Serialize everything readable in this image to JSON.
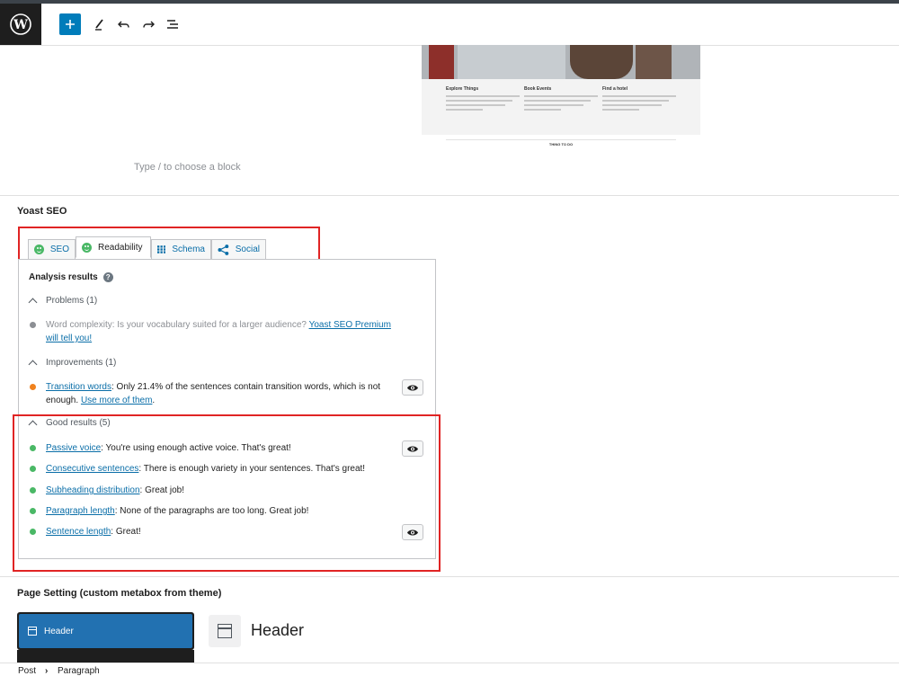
{
  "editor": {
    "preview": {
      "columns": [
        {
          "title": "Explore Things"
        },
        {
          "title": "Book Events"
        },
        {
          "title": "Find a hotel"
        }
      ],
      "footer_label": "THING TO DO"
    },
    "block_placeholder": "Type / to choose a block"
  },
  "yoast": {
    "title": "Yoast SEO",
    "tabs": [
      {
        "label": "SEO",
        "icon": "smiley-icon"
      },
      {
        "label": "Readability",
        "icon": "smiley-icon",
        "active": true
      },
      {
        "label": "Schema",
        "icon": "grid-icon"
      },
      {
        "label": "Social",
        "icon": "share-icon"
      }
    ],
    "analysis_title": "Analysis results",
    "help_glyph": "?",
    "problems": {
      "header": "Problems (1)",
      "items": [
        {
          "text": "Word complexity: Is your vocabulary suited for a larger audience? ",
          "link": "Yoast SEO Premium will tell you!"
        }
      ]
    },
    "improvements": {
      "header": "Improvements (1)",
      "items": [
        {
          "link": "Transition words",
          "text": ": Only 21.4% of the sentences contain transition words, which is not enough. ",
          "link2": "Use more of them",
          "end": "."
        }
      ]
    },
    "good": {
      "header": "Good results (5)",
      "items": [
        {
          "link": "Passive voice",
          "text": ": You're using enough active voice. That's great!"
        },
        {
          "link": "Consecutive sentences",
          "text": ": There is enough variety in your sentences. That's great!"
        },
        {
          "link": "Subheading distribution",
          "text": ": Great job!"
        },
        {
          "link": "Paragraph length",
          "text": ": None of the paragraphs are too long. Great job!"
        },
        {
          "link": "Sentence length",
          "text": ": Great!"
        }
      ]
    },
    "colors": {
      "good": "#4ab866",
      "ok": "#f0821e",
      "problem": "#8c8f94",
      "highlight": "#e02424"
    }
  },
  "page_setting": {
    "title": "Page Setting (custom metabox from theme)",
    "active_item": "Header",
    "panel_title": "Header"
  },
  "breadcrumb": {
    "items": [
      "Post",
      "Paragraph"
    ],
    "separator": "›"
  }
}
